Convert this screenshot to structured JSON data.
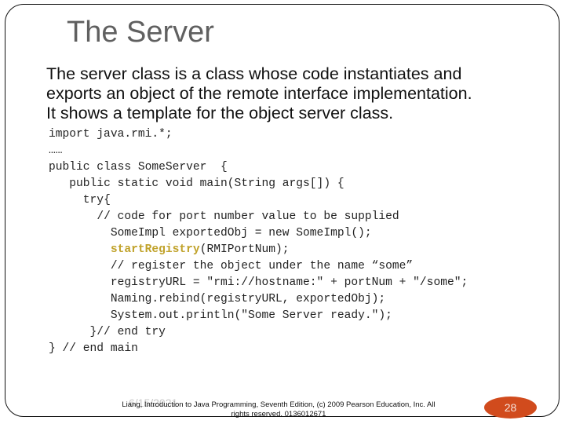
{
  "slide": {
    "title": "The Server",
    "body_lines": [
      "The server class is a class whose code instantiates and",
      "exports an object of the remote interface implementation.",
      "It shows a template for the object server class."
    ],
    "code_lines": [
      {
        "indent": "",
        "text": "import java.rmi.*;"
      },
      {
        "indent": "",
        "text": "……"
      },
      {
        "indent": "",
        "text": "public class SomeServer  {"
      },
      {
        "indent": "   ",
        "text": "public static void main(String args[]) {"
      },
      {
        "indent": "     ",
        "text": "try{"
      },
      {
        "indent": "       ",
        "text": "// code for port number value to be supplied"
      },
      {
        "indent": "         ",
        "text": "SomeImpl exportedObj = new SomeImpl();"
      },
      {
        "indent": "         ",
        "highlight": "startRegistry",
        "text": "(RMIPortNum);"
      },
      {
        "indent": "         ",
        "text": "// register the object under the name “some”"
      },
      {
        "indent": "         ",
        "text": "registryURL = \"rmi://hostname:\" + portNum + \"/some\";"
      },
      {
        "indent": "         ",
        "text": "Naming.rebind(registryURL, exportedObj);"
      },
      {
        "indent": "         ",
        "text": "System.out.println(\"Some Server ready.\");"
      },
      {
        "indent": "      ",
        "text": "}// end try"
      },
      {
        "indent": "",
        "text": "} // end main"
      }
    ],
    "highlight_color": "#c0a22a"
  },
  "footer": {
    "date": "6/15/2021",
    "line1": "Liang, Introduction to Java Programming, Seventh Edition, (c) 2009 Pearson Education, Inc. All",
    "line2": "rights reserved. 0136012671",
    "page_number": "28",
    "badge_color": "#d14b1d"
  }
}
